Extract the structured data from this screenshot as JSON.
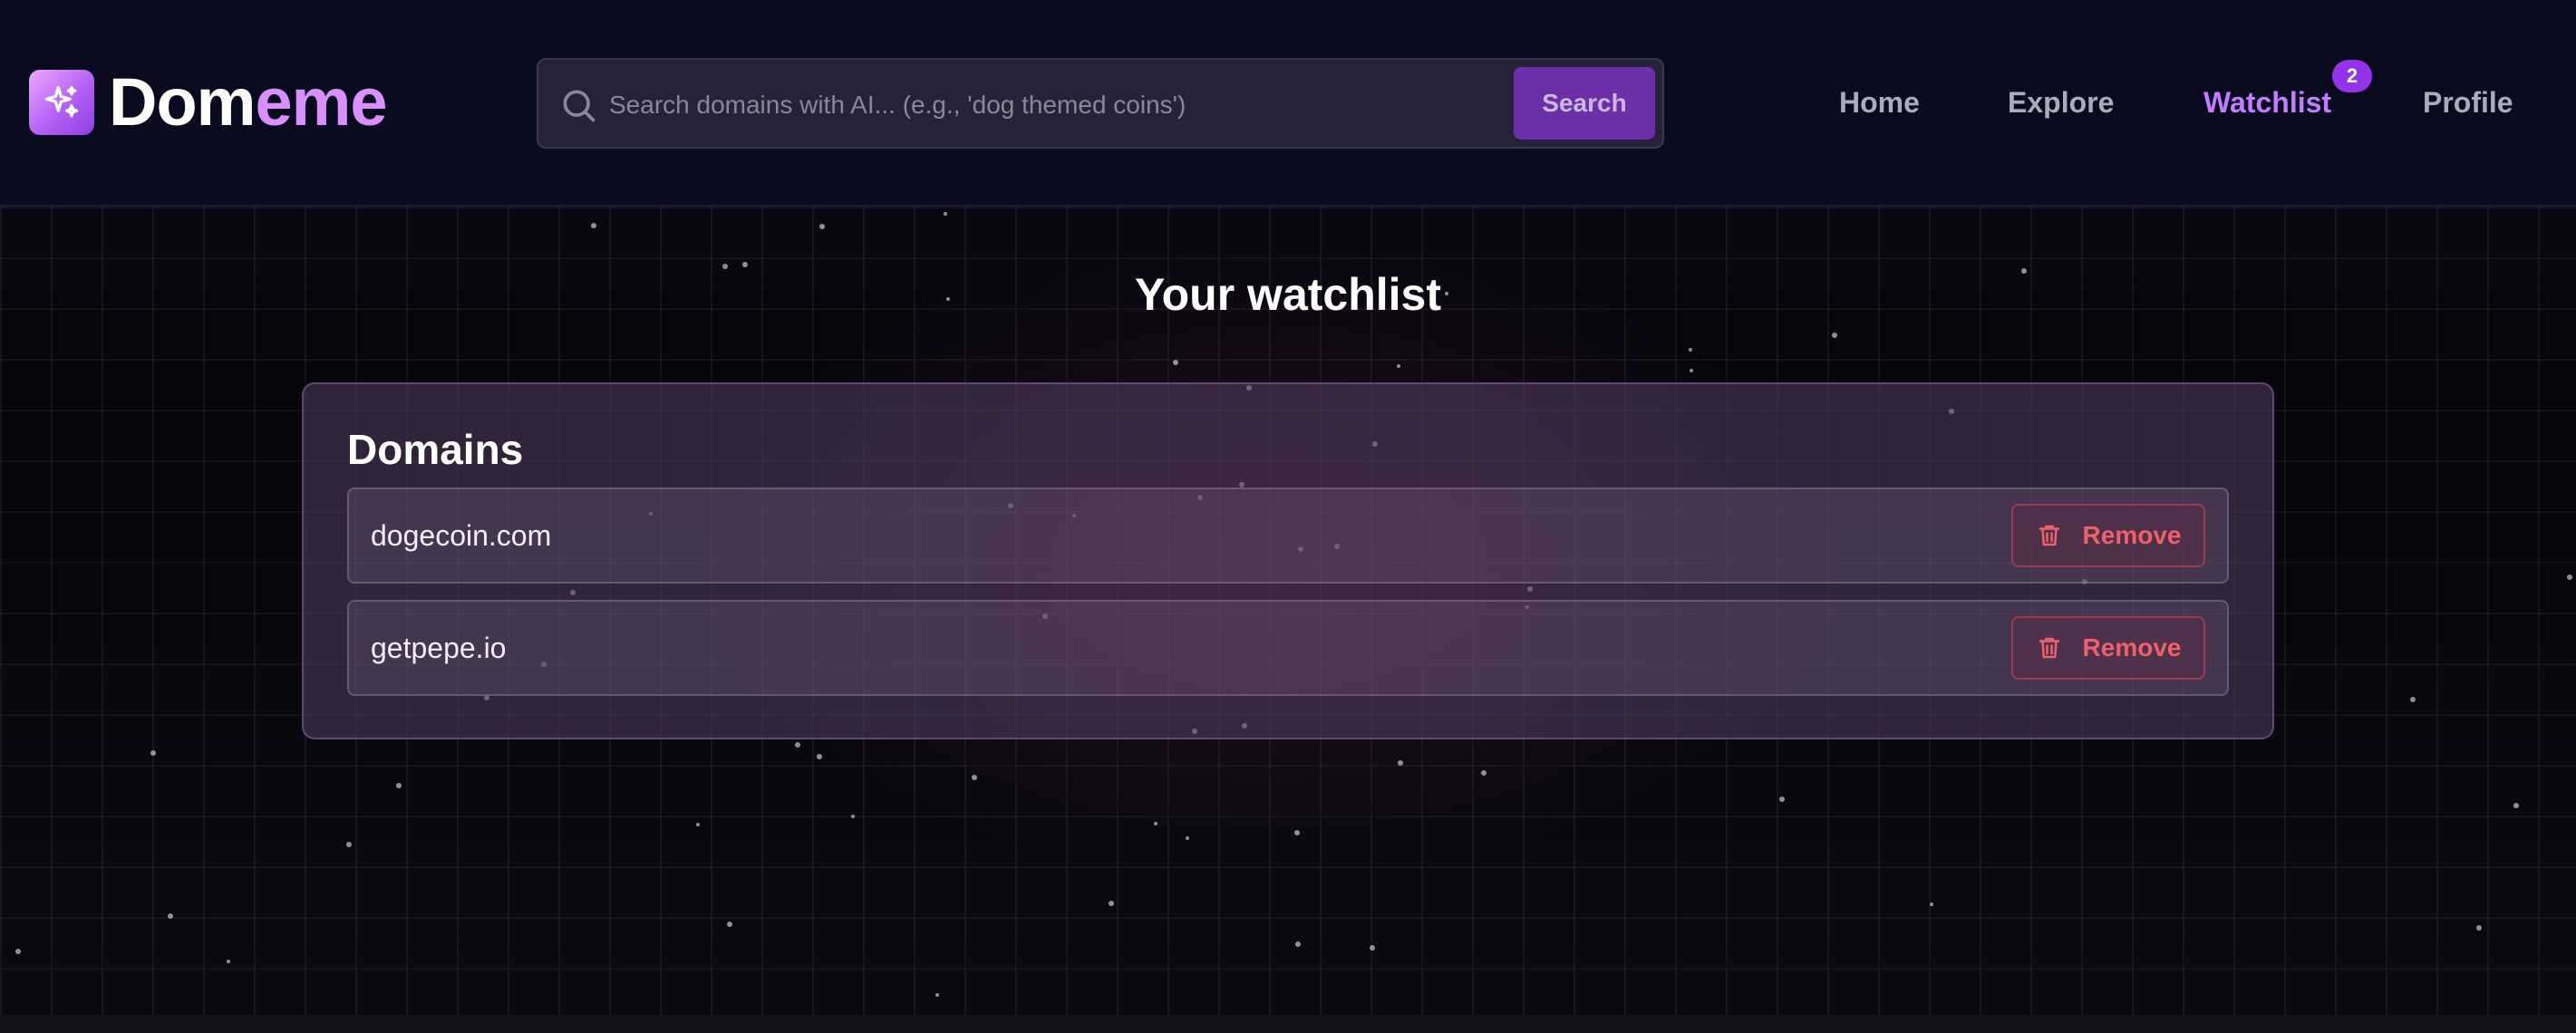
{
  "brand": {
    "name_part1": "Dom",
    "name_part2": "eme"
  },
  "search": {
    "placeholder": "Search domains with AI... (e.g., 'dog themed coins')",
    "button_label": "Search"
  },
  "nav": {
    "items": [
      {
        "label": "Home"
      },
      {
        "label": "Explore"
      },
      {
        "label": "Watchlist",
        "active": true,
        "badge": "2"
      },
      {
        "label": "Profile"
      }
    ]
  },
  "main": {
    "title": "Your watchlist",
    "panel_title": "Domains",
    "domains": [
      {
        "name": "dogecoin.com",
        "action_label": "Remove"
      },
      {
        "name": "getpepe.io",
        "action_label": "Remove"
      }
    ]
  },
  "colors": {
    "accent": "#c27cff",
    "badge": "#9333ea",
    "danger": "#f0606c",
    "search_button": "#6b2fa8"
  },
  "icons": {
    "logo": "sparkles-icon",
    "search": "search-icon",
    "remove": "trash-icon"
  }
}
